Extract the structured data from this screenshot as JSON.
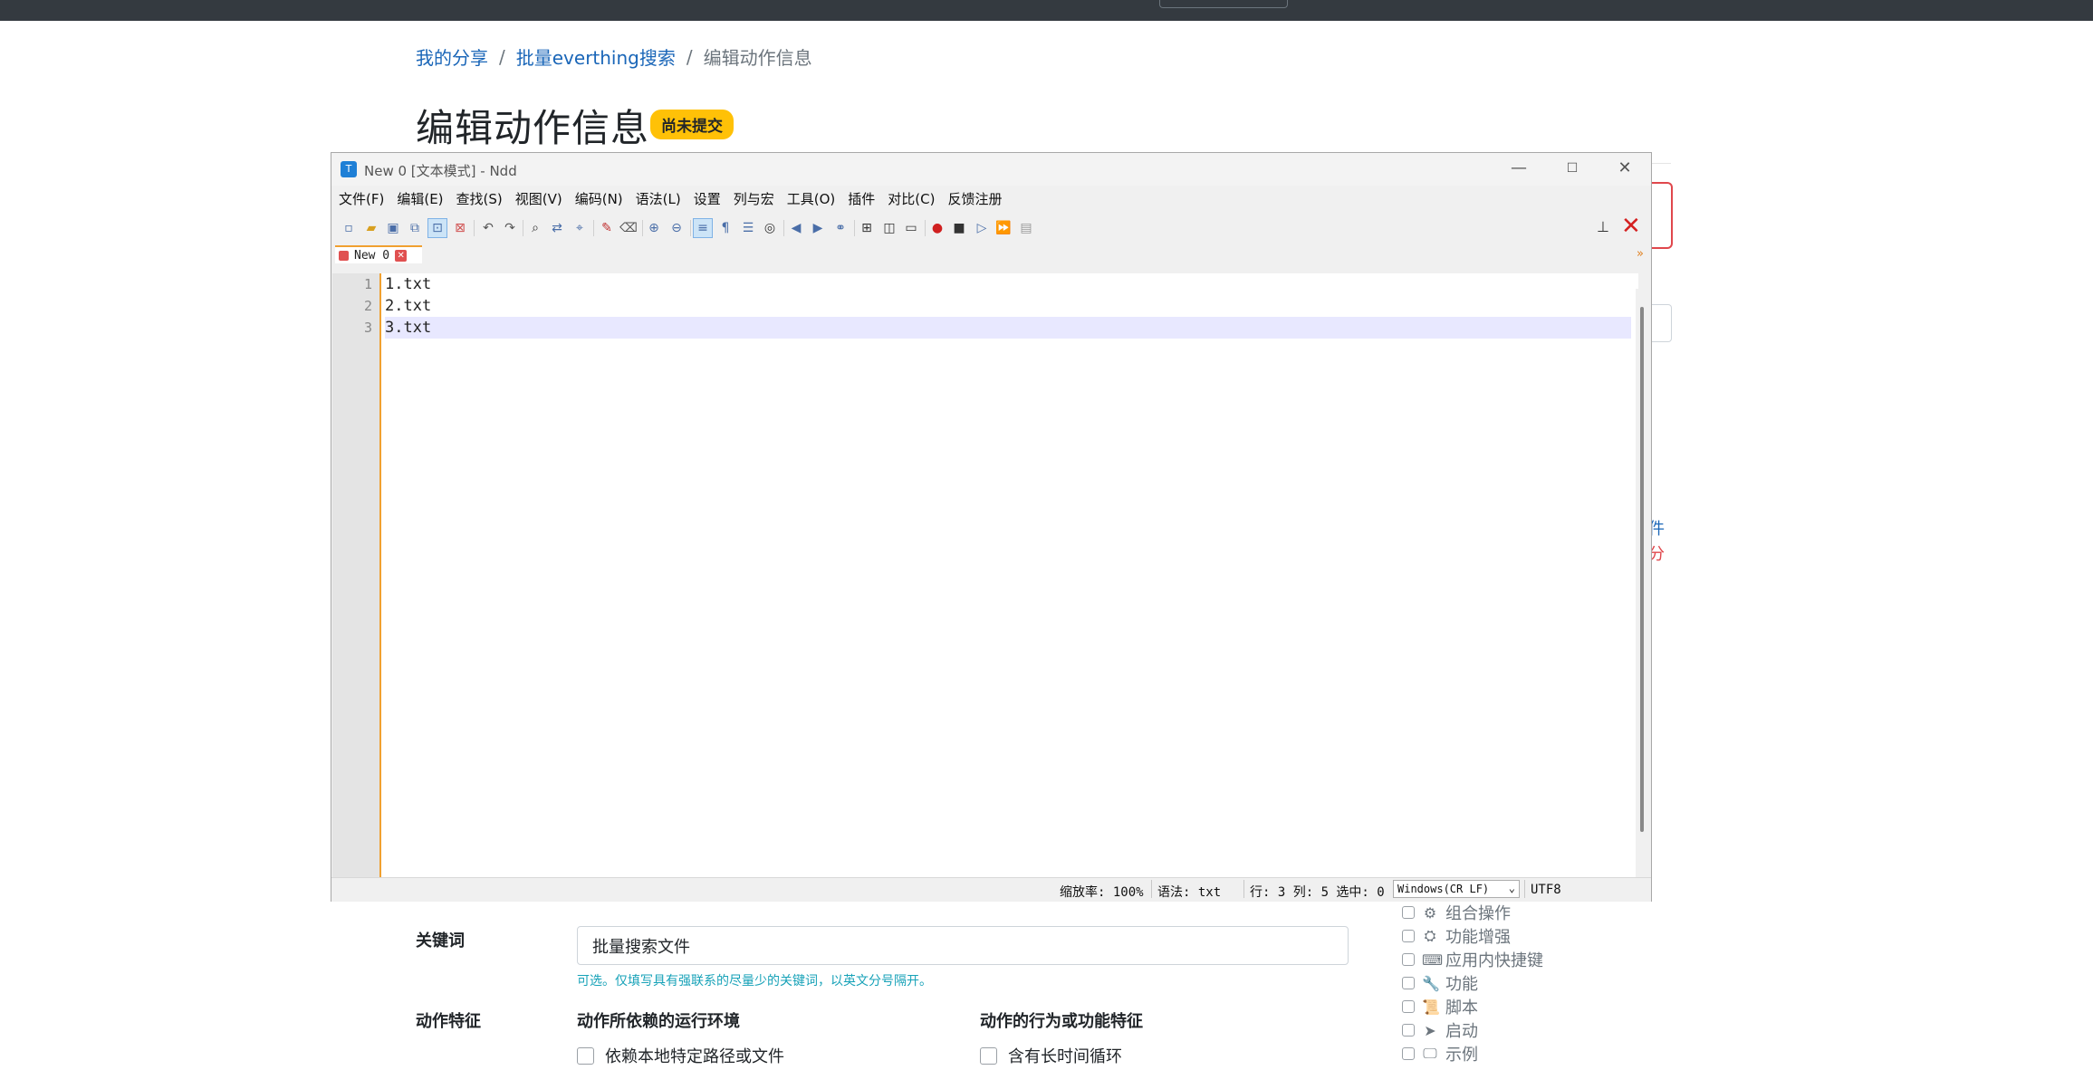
{
  "breadcrumb": {
    "items": [
      "我的分享",
      "批量everthing搜索"
    ],
    "current": "编辑动作信息",
    "sep": "/"
  },
  "page": {
    "title": "编辑动作信息",
    "badge": "尚未提交",
    "edge_text_1": "件",
    "edge_text_2": "分"
  },
  "form": {
    "keyword_label": "关键词",
    "keyword_value": "批量搜索文件",
    "keyword_help": "可选。仅填写具有强联系的尽量少的关键词，以英文分号隔开。",
    "features_label": "动作特征",
    "env_heading": "动作所依赖的运行环境",
    "behavior_heading": "动作的行为或功能特征",
    "env_option": "依赖本地特定路径或文件",
    "behavior_option": "含有长时间循环"
  },
  "tags": [
    {
      "label": "组合操作",
      "icon": "gears-icon",
      "glyph": "⚙"
    },
    {
      "label": "功能增强",
      "icon": "cubes-icon",
      "glyph": "⛭"
    },
    {
      "label": "应用内快捷键",
      "icon": "keyboard-icon",
      "glyph": "⌨"
    },
    {
      "label": "功能",
      "icon": "wrench-icon",
      "glyph": "🔧"
    },
    {
      "label": "脚本",
      "icon": "scroll-icon",
      "glyph": "📜"
    },
    {
      "label": "启动",
      "icon": "paper-plane-icon",
      "glyph": "➤"
    },
    {
      "label": "示例",
      "icon": "presentation-icon",
      "glyph": "🖵"
    }
  ],
  "ndd": {
    "title": "New 0 [文本模式] - Ndd",
    "app_icon_letter": "T",
    "minimize": "—",
    "maximize": "☐",
    "close": "✕",
    "menus": [
      "文件(F)",
      "编辑(E)",
      "查找(S)",
      "视图(V)",
      "编码(N)",
      "语法(L)",
      "设置",
      "列与宏",
      "工具(O)",
      "插件",
      "对比(C)",
      "反馈注册"
    ],
    "tab_name": "New 0",
    "tab_close": "✕",
    "pin": "📌",
    "panel_close": "✕",
    "collapse": "»",
    "lines": [
      "1.txt",
      "2.txt",
      "3.txt"
    ],
    "line_numbers": [
      "1",
      "2",
      "3"
    ],
    "status": {
      "zoom": "缩放率: 100%",
      "syntax": "语法: txt",
      "position": "行: 3 列: 5 选中: 0",
      "eol": "Windows(CR LF)",
      "encoding": "UTF8"
    }
  }
}
